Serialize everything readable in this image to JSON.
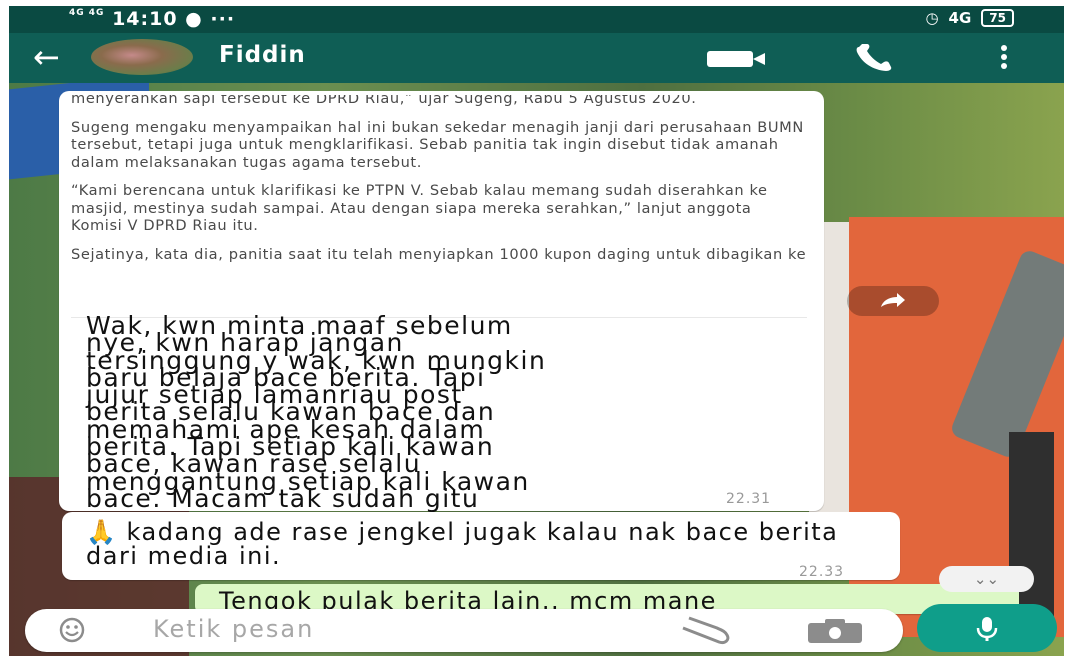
{
  "status_bar": {
    "time": "14:10",
    "signal": "4G 4G",
    "right_network": "4G",
    "battery": "75"
  },
  "header": {
    "contact_name": "Fiddin",
    "icons": [
      "back-arrow-icon",
      "avatar",
      "video-call-icon",
      "voice-call-icon",
      "more-options-icon"
    ]
  },
  "messages": [
    {
      "article_paragraphs": [
        "menyerahkan sapi tersebut ke DPRD Riau,” ujar Sugeng, Rabu 5 Agustus 2020.",
        "Sugeng mengaku menyampaikan hal ini bukan sekedar menagih janji dari perusahaan BUMN tersebut, tetapi juga untuk mengklarifikasi. Sebab panitia tak ingin disebut tidak amanah dalam melaksanakan tugas agama tersebut.",
        "“Kami berencana untuk klarifikasi ke PTPN V. Sebab kalau memang sudah diserahkan ke masjid, mestinya sudah sampai. Atau dengan siapa mereka serahkan,” lanjut anggota Komisi V DPRD Riau itu.",
        "Sejatinya, kata dia, panitia saat itu telah menyiapkan 1000 kupon daging untuk dibagikan ke"
      ],
      "text": "Wak, kwn minta maaf sebelum\nnye, kwn harap jangan\ntersinggung y wak, kwn mungkin\nbaru belaja bace berita. Tapi\njujur setiap lamanriau post\nberita selalu kawan bace dan\nmemahami ape kesah dalam\nberita. Tapi setiap kali kawan\nbace, kawan rase selalu\nmenggantung setiap kali kawan\nbace. Macam tak sudah gitu",
      "time": "22.31"
    },
    {
      "emoji": "🙏",
      "text": " kadang ade rase jengkel jugak kalau nak bace berita dari media ini.",
      "time": "22.33"
    },
    {
      "text": "Tengok pulak berita lain.. mcm mane"
    }
  ],
  "input": {
    "placeholder": "Ketik pesan"
  },
  "colors": {
    "header": "#0f5e55",
    "status_bar": "#0a4a42",
    "outgoing_bubble": "#dcf8c6",
    "mic_button": "#0f9e8a"
  }
}
